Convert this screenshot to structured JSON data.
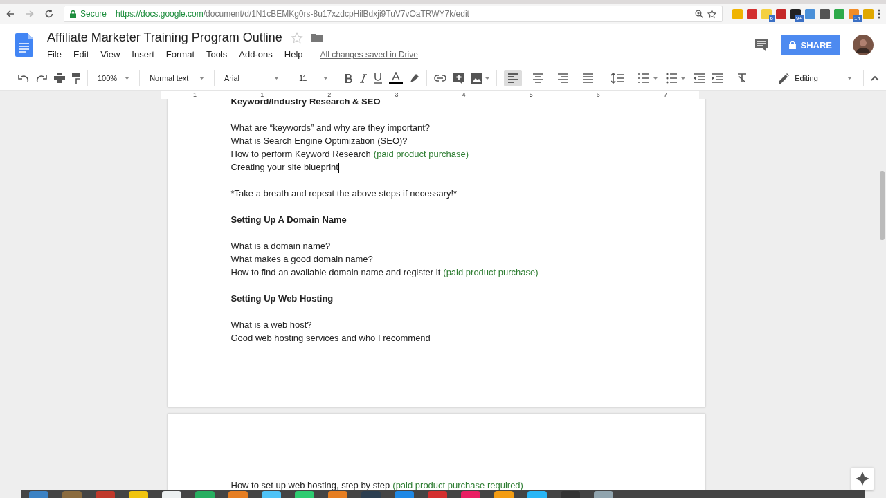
{
  "browser": {
    "secure_label": "Secure",
    "url_host": "https://docs.google.com",
    "url_path": "/document/d/1N1cBEMKg0rs-8u17xzdcpHilBdxji9TuV7vOaTRWY7k/edit",
    "extensions": [
      {
        "color": "#f0b400"
      },
      {
        "color": "#d32f2f"
      },
      {
        "color": "#f4d03f",
        "badge": "6"
      },
      {
        "color": "#c62828"
      },
      {
        "color": "#222222",
        "badge": "9+"
      },
      {
        "color": "#4a90d9"
      },
      {
        "color": "#555555"
      },
      {
        "color": "#2eaa4a"
      },
      {
        "color": "#f28c28",
        "badge": "14"
      },
      {
        "color": "#e0a800"
      }
    ]
  },
  "doc": {
    "title": "Affiliate Marketer Training Program Outline",
    "menus": [
      "File",
      "Edit",
      "View",
      "Insert",
      "Format",
      "Tools",
      "Add-ons",
      "Help"
    ],
    "save_status": "All changes saved in Drive",
    "share": "SHARE"
  },
  "toolbar": {
    "zoom": "100%",
    "style": "Normal text",
    "font": "Arial",
    "size": "11",
    "mode": "Editing",
    "align": [
      {
        "kind": "left",
        "selected": true
      },
      {
        "kind": "center",
        "selected": false
      },
      {
        "kind": "right",
        "selected": false
      },
      {
        "kind": "justify",
        "selected": false
      }
    ]
  },
  "ruler": [
    "1",
    "1",
    "2",
    "3",
    "4",
    "5",
    "6",
    "7"
  ],
  "pages": [
    {
      "blocks": [
        {
          "kind": "heading",
          "text": "Keyword/Industry Research & SEO"
        },
        {
          "kind": "blank"
        },
        {
          "kind": "line",
          "text": "What are “keywords” and why are they important?"
        },
        {
          "kind": "line",
          "text": "What is Search Engine Optimization (SEO)?"
        },
        {
          "kind": "line",
          "text": "How to perform Keyword Research",
          "note": "(paid product purchase)"
        },
        {
          "kind": "line",
          "text": "Creating your site blueprint",
          "cursor": true
        },
        {
          "kind": "blank"
        },
        {
          "kind": "line",
          "text": "*Take a breath and repeat the above steps if necessary!*"
        },
        {
          "kind": "blank"
        },
        {
          "kind": "heading",
          "text": "Setting Up A Domain Name"
        },
        {
          "kind": "blank"
        },
        {
          "kind": "line",
          "text": "What is a domain name?"
        },
        {
          "kind": "line",
          "text": "What makes a good domain name?"
        },
        {
          "kind": "line",
          "text": "How to find an available domain name and register it",
          "note": "(paid product purchase)"
        },
        {
          "kind": "blank"
        },
        {
          "kind": "heading",
          "text": "Setting Up Web Hosting"
        },
        {
          "kind": "blank"
        },
        {
          "kind": "line",
          "text": "What is a web host?"
        },
        {
          "kind": "line",
          "text": "Good web hosting services and who I recommend"
        }
      ]
    },
    {
      "blocks": [
        {
          "kind": "line",
          "text": "How to set up web hosting, step by step",
          "note": "(paid product purchase required)"
        }
      ]
    }
  ],
  "dock": [
    {
      "color": "#3b82c4"
    },
    {
      "color": "#8b6b3e"
    },
    {
      "color": "#c0392b"
    },
    {
      "color": "#f1c40f"
    },
    {
      "color": "#ecf0f1"
    },
    {
      "color": "#27ae60"
    },
    {
      "color": "#e67e22"
    },
    {
      "color": "#4fc3f7"
    },
    {
      "color": "#2ecc71"
    },
    {
      "color": "#e67e21"
    },
    {
      "color": "#2c3e50"
    },
    {
      "color": "#1e88e5"
    },
    {
      "color": "#d32f2f"
    },
    {
      "color": "#e91e63"
    },
    {
      "color": "#f39c12"
    },
    {
      "color": "#29b6f6"
    },
    {
      "color": "#333333"
    },
    {
      "color": "#90a4ae"
    }
  ]
}
